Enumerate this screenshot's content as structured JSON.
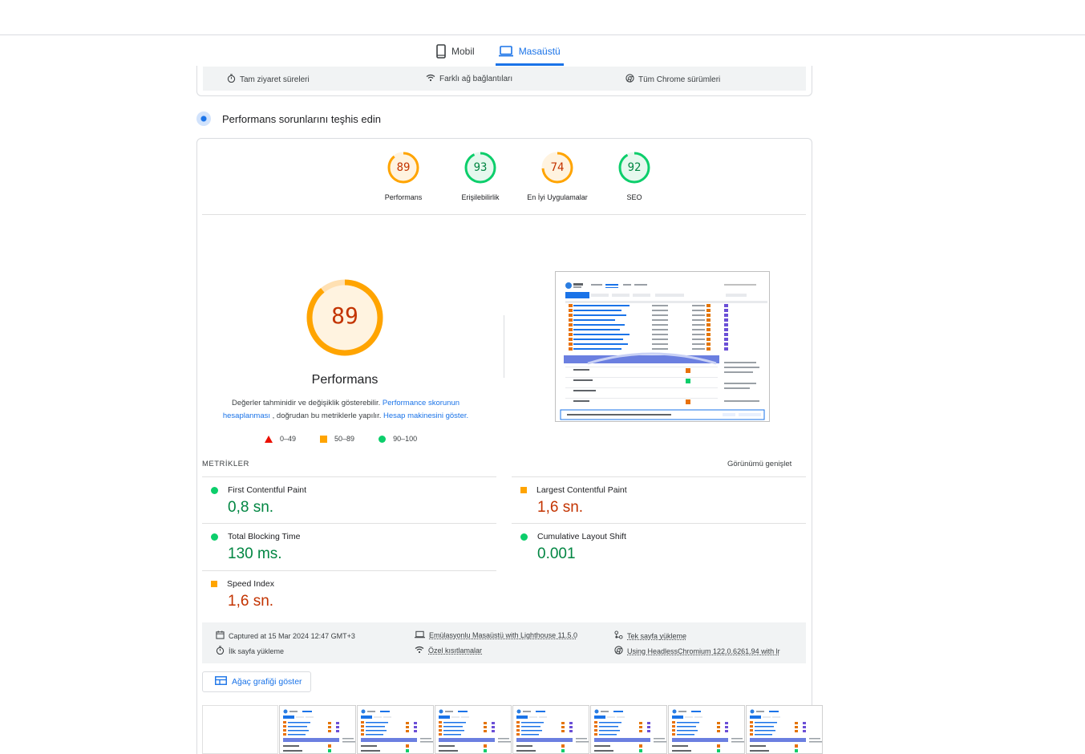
{
  "device_tabs": {
    "mobile": "Mobil",
    "desktop": "Masaüstü"
  },
  "field_data": {
    "items": [
      "Tam ziyaret süreleri",
      "Farklı ağ bağlantıları",
      "Tüm Chrome sürümleri"
    ]
  },
  "diagnose": {
    "title": "Performans sorunlarını teşhis edin"
  },
  "categories": [
    {
      "score": "89",
      "label": "Performans",
      "color": "#ffa400",
      "text_color": "#c33300",
      "fraction": 0.89
    },
    {
      "score": "93",
      "label": "Erişilebilirlik",
      "color": "#0cce6b",
      "text_color": "#018642",
      "fraction": 0.93
    },
    {
      "score": "74",
      "label": "En İyi Uygulamalar",
      "color": "#ffa400",
      "text_color": "#c33300",
      "fraction": 0.74
    },
    {
      "score": "92",
      "label": "SEO",
      "color": "#0cce6b",
      "text_color": "#018642",
      "fraction": 0.92
    }
  ],
  "performance": {
    "score": "89",
    "fraction": 0.89,
    "label": "Performans",
    "desc_1": "Değerler tahminidir ve değişiklik gösterebilir. ",
    "link_1": "Performance skorunun hesaplanması",
    "desc_2": " , doğrudan bu metriklerle yapılır. ",
    "link_2": "Hesap makinesini göster."
  },
  "legend": {
    "bad": "0–49",
    "average": "50–89",
    "good": "90–100"
  },
  "metrics_section": {
    "title": "METRİKLER",
    "expand_label": "Görünümü genişlet",
    "items": [
      {
        "name": "First Contentful Paint",
        "value": "0,8 sn.",
        "status": "good"
      },
      {
        "name": "Largest Contentful Paint",
        "value": "1,6 sn.",
        "status": "average"
      },
      {
        "name": "Total Blocking Time",
        "value": "130 ms.",
        "status": "good"
      },
      {
        "name": "Cumulative Layout Shift",
        "value": "0.001",
        "status": "good"
      },
      {
        "name": "Speed Index",
        "value": "1,6 sn.",
        "status": "average"
      }
    ]
  },
  "run_info": {
    "captured": "Captured at 15 Mar 2024 12:47 GMT+3",
    "first_load": "İlk sayfa yükleme",
    "emulation": "Emülasyonlu Masaüstü with Lighthouse 11.5.0",
    "throttling": "Özel kısıtlamalar",
    "single_page": "Tek sayfa yükleme",
    "browser": "Using HeadlessChromium 122.0.6261.94 with lr"
  },
  "tree_button": {
    "label": "Ağaç grafiği göster"
  },
  "colors": {
    "accent": "#1a73e8",
    "good": "#0cce6b",
    "average": "#ffa400",
    "bad": "#eb0f00",
    "good_text": "#018642",
    "average_text": "#c33300"
  }
}
